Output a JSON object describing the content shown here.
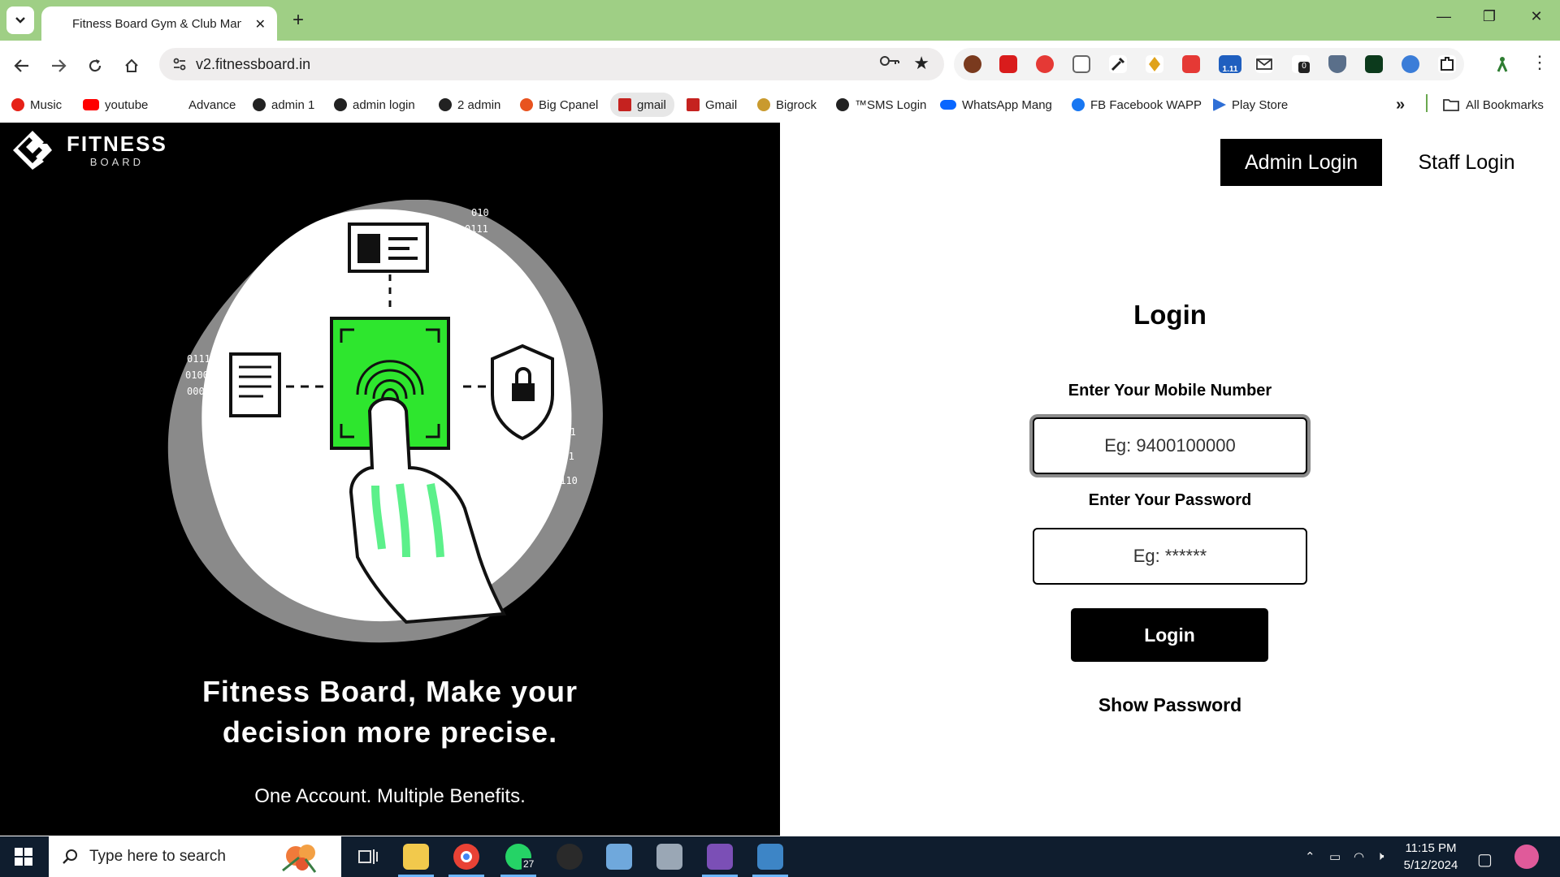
{
  "browser": {
    "tab_title": "Fitness Board Gym & Club Management",
    "tab_close": "✕",
    "new_tab": "+",
    "url": "v2.fitnessboard.in",
    "ext_badges": {
      "queue": "1.11",
      "cloud": "0"
    },
    "bookmarks": [
      {
        "label": "Music",
        "icon_color": "#e62117"
      },
      {
        "label": "youtube",
        "icon_color": "#ff0000"
      },
      {
        "label": "Advance",
        "icon_color": ""
      },
      {
        "label": "admin 1",
        "icon_color": "#222222"
      },
      {
        "label": "admin login",
        "icon_color": "#222222"
      },
      {
        "label": "2 admin",
        "icon_color": "#222222"
      },
      {
        "label": "Big Cpanel",
        "icon_color": "#e8531f"
      },
      {
        "label": "gmail",
        "icon_color": "#c5221f"
      },
      {
        "label": "Gmail",
        "icon_color": "#c5221f"
      },
      {
        "label": "Bigrock",
        "icon_color": "#c99a2e"
      },
      {
        "label": "™SMS Login",
        "icon_color": "#222222"
      },
      {
        "label": "WhatsApp Mang",
        "icon_color": "#0866ff"
      },
      {
        "label": "FB Facebook WAPP",
        "icon_color": "#1877f2"
      },
      {
        "label": "Play Store",
        "icon_color": "#2f6fd6"
      }
    ],
    "more_bookmarks": "»",
    "all_bookmarks": "All Bookmarks"
  },
  "page": {
    "headline": "Fitness Board, Make your decision more precise.",
    "subline": "One Account. Multiple Benefits.",
    "admin_login": "Admin Login",
    "staff_login": "Staff Login",
    "login_title": "Login",
    "mobile_label": "Enter Your Mobile Number",
    "mobile_placeholder": "Eg: 9400100000",
    "password_label": "Enter Your Password",
    "password_placeholder": "Eg: ******",
    "login_button": "Login",
    "show_password": "Show Password"
  },
  "taskbar": {
    "search_placeholder": "Type here to search",
    "whatsapp_badge": "27",
    "time": "11:15 PM",
    "date": "5/12/2024"
  },
  "colors": {
    "tabbar_bg": "#9fcf85",
    "fingerprint_green": "#2ee62e",
    "accent_green": "#5cf08a"
  }
}
